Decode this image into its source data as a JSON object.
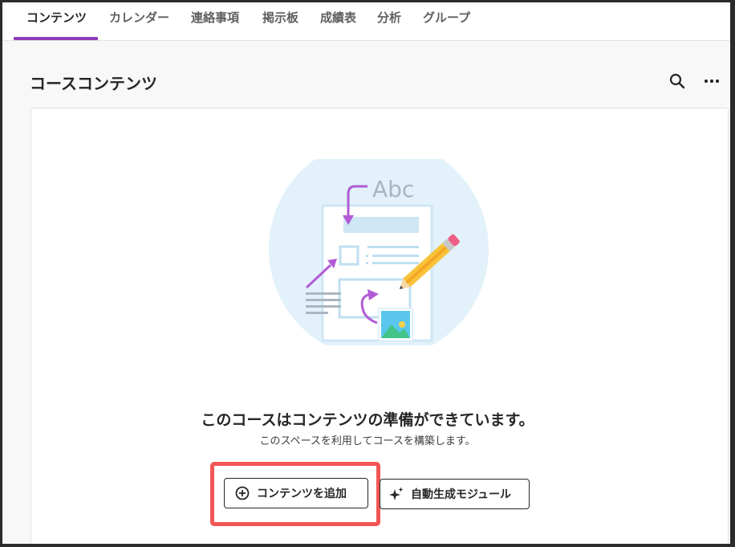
{
  "nav": {
    "tabs": [
      {
        "label": "コンテンツ",
        "active": true
      },
      {
        "label": "カレンダー"
      },
      {
        "label": "連絡事項"
      },
      {
        "label": "掲示板"
      },
      {
        "label": "成績表"
      },
      {
        "label": "分析"
      },
      {
        "label": "グループ"
      }
    ]
  },
  "header": {
    "title": "コースコンテンツ",
    "search_icon": "search-icon",
    "more_icon": "more-options-icon"
  },
  "empty_state": {
    "illustration_text": "Abc",
    "title": "このコースはコンテンツの準備ができています。",
    "subtitle": "このスペースを利用してコースを構築します。"
  },
  "actions": {
    "add_content_label": "コンテンツを追加",
    "auto_generate_label": "自動生成モジュール"
  },
  "colors": {
    "accent": "#8e3bb7",
    "highlight": "#f25555"
  }
}
